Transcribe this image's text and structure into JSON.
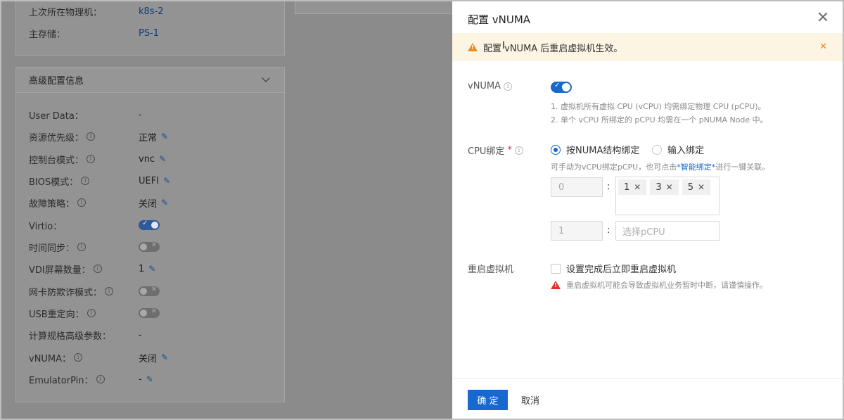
{
  "background": {
    "top_rows": [
      {
        "label": "上次所在物理机：",
        "value": "k8s-2"
      },
      {
        "label": "主存储：",
        "value": "PS-1"
      }
    ],
    "advanced": {
      "title": "高级配置信息",
      "rows": [
        {
          "label": "User Data：",
          "value": "-"
        },
        {
          "label": "资源优先级：",
          "value": "正常"
        },
        {
          "label": "控制台模式：",
          "value": "vnc"
        },
        {
          "label": "BIOS模式：",
          "value": "UEFI"
        },
        {
          "label": "故障策略：",
          "value": "关闭"
        },
        {
          "label": "Virtio："
        },
        {
          "label": "时间同步："
        },
        {
          "label": "VDI屏幕数量：",
          "value": "1"
        },
        {
          "label": "网卡防欺诈模式："
        },
        {
          "label": "USB重定向："
        },
        {
          "label": "计算规格高级参数：",
          "value": "-"
        },
        {
          "label": "vNUMA：",
          "value": "关闭"
        },
        {
          "label": "EmulatorPin：",
          "value": "-"
        }
      ]
    }
  },
  "drawer": {
    "title": "配置 vNUMA",
    "alert": "配置 vNUMA 后重启虚拟机生效。",
    "vnuma": {
      "label": "vNUMA",
      "enabled": true,
      "help_1": "1. 虚拟机所有虚拟 CPU (vCPU) 均需绑定物理 CPU (pCPU)。",
      "help_2": "2. 单个 vCPU 所绑定的 pCPU 均需在一个 pNUMA Node 中。"
    },
    "cpu_binding": {
      "label": "CPU绑定",
      "required_mark": "*",
      "option_numa": "按NUMA结构绑定",
      "option_input": "输入绑定",
      "selected": "option_numa",
      "help_prefix": "可手动为vCPU绑定pCPU，也可点击",
      "help_link": "*智能绑定*",
      "help_suffix": "进行一键关联。",
      "rows": [
        {
          "vcpu": "0",
          "pcpus": [
            "1",
            "3",
            "5"
          ]
        },
        {
          "vcpu": "1",
          "pcpus": [],
          "placeholder": "选择pCPU"
        }
      ],
      "colon": ":"
    },
    "restart": {
      "label": "重启虚拟机",
      "checkbox_label": "设置完成后立即重启虚拟机",
      "warning": "重启虚拟机可能会导致虚拟机业务暂时中断，请谨慎操作。"
    },
    "footer": {
      "confirm": "确 定",
      "cancel": "取消"
    }
  },
  "colors": {
    "primary": "#1768cf",
    "warning": "#f08a1c",
    "danger": "#e5302d",
    "alert_bg": "#fdf5e4"
  }
}
